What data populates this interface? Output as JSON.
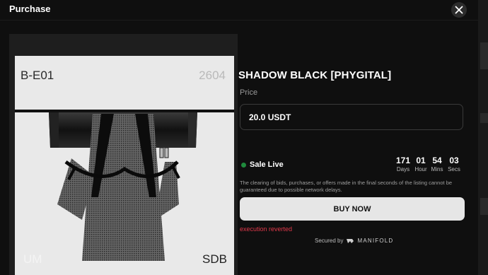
{
  "modal": {
    "title": "Purchase"
  },
  "artwork": {
    "top_left": "B-E01",
    "top_right": "2604",
    "bottom_left": "UM",
    "bottom_right": "SDB"
  },
  "product": {
    "title": "SHADOW BLACK [PHYGITAL]",
    "price_label": "Price",
    "price_value": "20.0 USDT"
  },
  "sale": {
    "status": "Sale Live",
    "status_color": "#1f8a3c",
    "countdown": [
      {
        "value": "171",
        "unit": "Days"
      },
      {
        "value": "01",
        "unit": "Hour"
      },
      {
        "value": "54",
        "unit": "Mins"
      },
      {
        "value": "03",
        "unit": "Secs"
      }
    ],
    "disclaimer": "The clearing of bids, purchases, or offers made in the final seconds of the listing cannot be guaranteed due to possible network delays."
  },
  "actions": {
    "buy_label": "BUY NOW",
    "error_text": "execution reverted",
    "error_color": "#e0384a"
  },
  "footer": {
    "secured_by": "Secured by",
    "brand": "MANIFOLD"
  }
}
